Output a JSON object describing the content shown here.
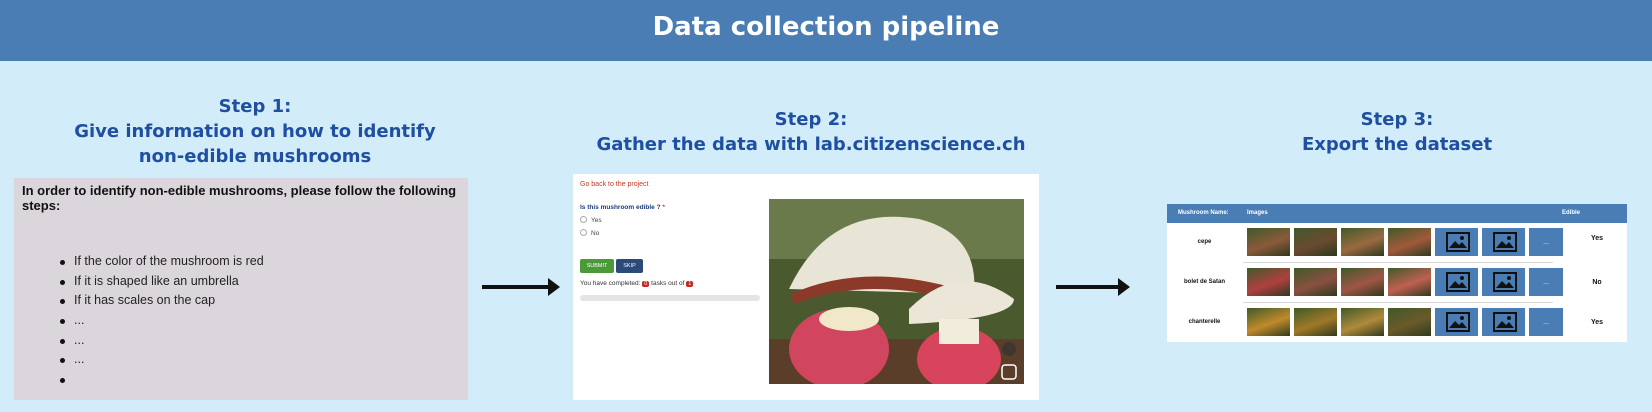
{
  "header": {
    "title": "Data collection pipeline"
  },
  "steps": [
    {
      "number": "Step 1:",
      "title": "Give information on how to identify non-edible mushrooms"
    },
    {
      "number": "Step 2:",
      "title": "Gather the data with lab.citizenscience.ch"
    },
    {
      "number": "Step 3:",
      "title": "Export the dataset"
    }
  ],
  "instructions": {
    "intro": "In order to identify non-edible mushrooms, please follow the following steps:",
    "bullets": [
      "If the color of the mushroom is red",
      "If it is shaped like an umbrella",
      "If it has scales on the cap",
      "...",
      "...",
      "...",
      ""
    ]
  },
  "task_form": {
    "back_link": "Go back to the project",
    "question": "Is this mushroom edible ?",
    "required_mark": "*",
    "options": [
      "Yes",
      "No"
    ],
    "submit_label": "SUBMIT",
    "skip_label": "SKIP",
    "progress_prefix": "You have completed:",
    "progress_middle": "tasks out of",
    "completed": "0",
    "total": "1",
    "progress_fraction": 0
  },
  "dataset": {
    "columns": [
      "Mushroom Name:",
      "Images",
      "Edible"
    ],
    "more_label": "...",
    "rows": [
      {
        "name": "cepe",
        "edible": "Yes"
      },
      {
        "name": "bolet de Satan",
        "edible": "No"
      },
      {
        "name": "chanterelle",
        "edible": "Yes"
      }
    ]
  },
  "colors": {
    "header": "#4a7db3",
    "background": "#d2ecf9",
    "step_title": "#1e4fa0",
    "submit": "#4a9a3a",
    "skip": "#2b4a78"
  }
}
